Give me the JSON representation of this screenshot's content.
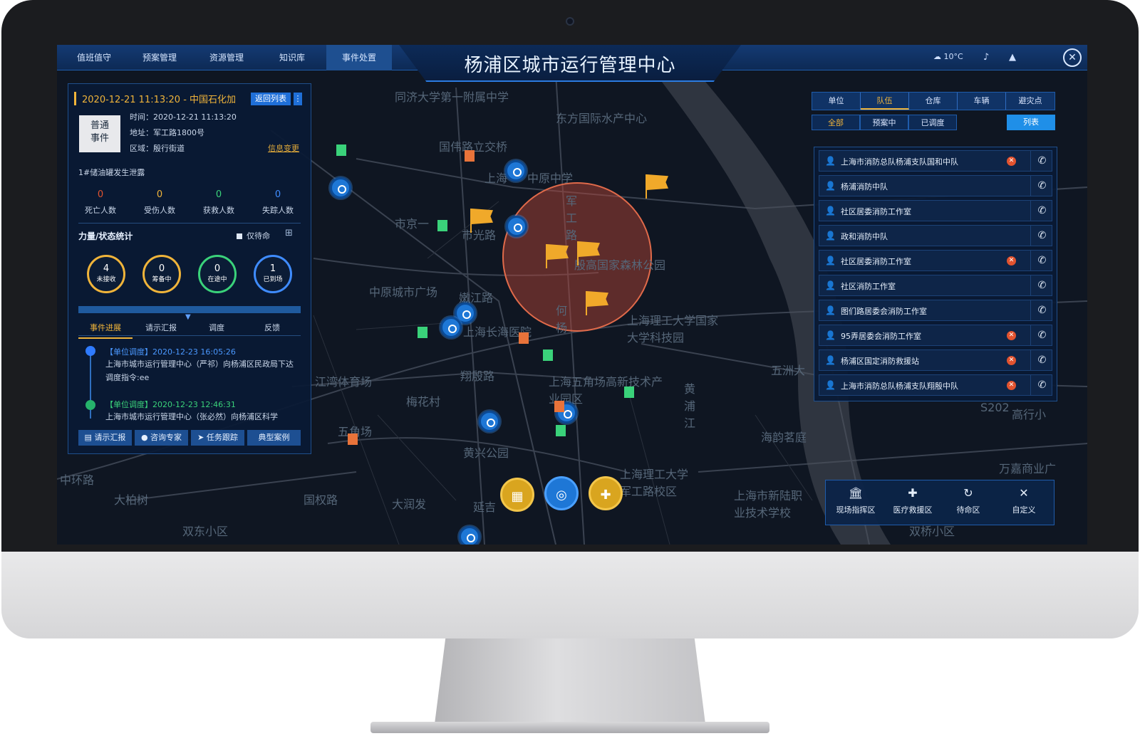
{
  "app": {
    "title": "杨浦区城市运行管理中心"
  },
  "nav": [
    "值班值守",
    "预案管理",
    "资源管理",
    "知识库",
    "事件处置"
  ],
  "topbar": {
    "weather": "10°C",
    "close_icon": "close-icon"
  },
  "event": {
    "header": "2020-12-21 11:13:20 - 中国石化加",
    "back_label": "返回列表",
    "more_label": "⋮",
    "badge_line1": "普通",
    "badge_line2": "事件",
    "time": "时间：2020-12-21 11:13:20",
    "address": "地址：军工路1800号",
    "area": "区域：殷行街道",
    "change_label": "信息变更",
    "description": "1#储油罐发生泄露",
    "stats": [
      {
        "value": "0",
        "label": "死亡人数",
        "color": "#e2532f"
      },
      {
        "value": "0",
        "label": "受伤人数",
        "color": "#f0b43a"
      },
      {
        "value": "0",
        "label": "获救人数",
        "color": "#3ad27a"
      },
      {
        "value": "0",
        "label": "失踪人数",
        "color": "#3f8cff"
      }
    ],
    "force_title": "力量/状态统计",
    "only_label": "仅待命",
    "rings": [
      {
        "value": "4",
        "label": "未接收",
        "color": "#f0b43a"
      },
      {
        "value": "0",
        "label": "筹备中",
        "color": "#f0b43a"
      },
      {
        "value": "0",
        "label": "在途中",
        "color": "#3ad27a"
      },
      {
        "value": "1",
        "label": "已到场",
        "color": "#3f8cff"
      }
    ],
    "tabs": [
      "事件进展",
      "请示汇报",
      "调度",
      "反馈"
    ],
    "timeline": [
      {
        "head": "【单位调度】2020-12-23 16:05:26",
        "text": "上海市城市运行管理中心（严祁）向杨浦区民政局下达调度指令:ee",
        "color": "#2f7bff"
      },
      {
        "head": "【单位调度】2020-12-23 12:46:31",
        "text": "上海市城市运行管理中心（张必然）向杨浦区科学",
        "color": "#26b36b"
      }
    ],
    "actions": [
      "请示汇报",
      "咨询专家",
      "任务跟踪",
      "典型案例"
    ]
  },
  "right": {
    "tabs": [
      "单位",
      "队伍",
      "仓库",
      "车辆",
      "避灾点"
    ],
    "subtabs": [
      "全部",
      "预案中",
      "已调度"
    ],
    "list_label": "列表",
    "teams": [
      {
        "name": "上海市消防总队杨浦支队国和中队",
        "warn": true
      },
      {
        "name": "杨浦消防中队",
        "warn": false
      },
      {
        "name": "社区居委消防工作室",
        "warn": false
      },
      {
        "name": "政和消防中队",
        "warn": false
      },
      {
        "name": "社区居委消防工作室",
        "warn": true
      },
      {
        "name": "社区消防工作室",
        "warn": false
      },
      {
        "name": "图们路居委会消防工作室",
        "warn": false
      },
      {
        "name": "95弄居委会消防工作室",
        "warn": true
      },
      {
        "name": "杨浦区国定消防救援站",
        "warn": true
      },
      {
        "name": "上海市消防总队杨浦支队翔殷中队",
        "warn": true
      }
    ]
  },
  "bottom_bar": [
    {
      "icon": "🏛",
      "label": "现场指挥区"
    },
    {
      "icon": "✚",
      "label": "医疗救援区"
    },
    {
      "icon": "↻",
      "label": "待命区"
    },
    {
      "icon": "✕",
      "label": "自定义"
    }
  ],
  "map_labels": [
    "同济大学第一附属中学",
    "东方国际水产中心",
    "国伟路立交桥",
    "上海",
    "中原中学",
    "市京一",
    "市光路",
    "殷高国家森林公园",
    "中原城市广场",
    "嫩江路",
    "上海长海医院",
    "上海理工大学国家大学科技园",
    "江湾体育场",
    "翔殷路",
    "上海五角场高新技术产业园区",
    "梅花村",
    "五角场",
    "黄兴公园",
    "上海理工大学军工路校区",
    "大润发",
    "延吉",
    "大柏树",
    "中环路",
    "国权路",
    "双东小区",
    "海韵茗庭",
    "上海市新陆职业技术学校",
    "万嘉商业广",
    "五洲大",
    "双桥小区",
    "高行小",
    "S202",
    "黄浦江",
    "军工路",
    "何杨"
  ],
  "colors": {
    "accent": "#1f6fd8",
    "warn": "#e2532f",
    "gold": "#f0b43a",
    "green": "#3ad27a"
  }
}
